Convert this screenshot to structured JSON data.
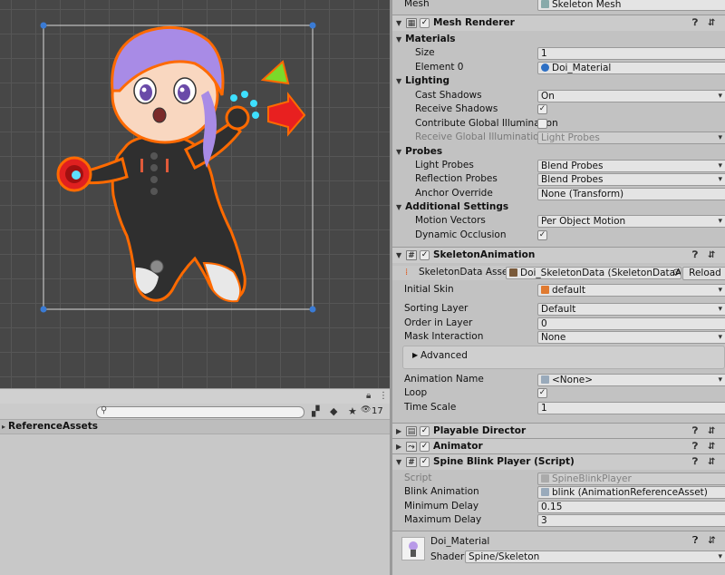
{
  "project": {
    "search_placeholder": "",
    "hidden_count": "17",
    "folder": "ReferenceAssets"
  },
  "inspector": {
    "mesh": {
      "label": "Mesh",
      "value": "Skeleton Mesh"
    },
    "mesh_renderer": {
      "title": "Mesh Renderer",
      "materials": {
        "section": "Materials",
        "size_label": "Size",
        "size": "1",
        "element0_label": "Element 0",
        "element0": "Doi_Material"
      },
      "lighting": {
        "section": "Lighting",
        "cast_shadows_label": "Cast Shadows",
        "cast_shadows": "On",
        "receive_shadows_label": "Receive Shadows",
        "receive_shadows": "✓",
        "contribute_gi_label": "Contribute Global Illumination",
        "contribute_gi": "",
        "receive_gi_label": "Receive Global Illumination",
        "receive_gi": "Light Probes"
      },
      "probes": {
        "section": "Probes",
        "light_probes_label": "Light Probes",
        "light_probes": "Blend Probes",
        "reflection_probes_label": "Reflection Probes",
        "reflection_probes": "Blend Probes",
        "anchor_override_label": "Anchor Override",
        "anchor_override": "None (Transform)"
      },
      "additional": {
        "section": "Additional Settings",
        "motion_vectors_label": "Motion Vectors",
        "motion_vectors": "Per Object Motion",
        "dynamic_occlusion_label": "Dynamic Occlusion",
        "dynamic_occlusion": "✓"
      }
    },
    "skeleton_animation": {
      "title": "SkeletonAnimation",
      "data_asset_label": "SkeletonData Asset",
      "data_asset": "Doi_SkeletonData (SkeletonDataAsset)",
      "reload": "Reload",
      "initial_skin_label": "Initial Skin",
      "initial_skin": "default",
      "sorting_layer_label": "Sorting Layer",
      "sorting_layer": "Default",
      "order_in_layer_label": "Order in Layer",
      "order_in_layer": "0",
      "mask_interaction_label": "Mask Interaction",
      "mask_interaction": "None",
      "advanced": "Advanced",
      "animation_name_label": "Animation Name",
      "animation_name": "<None>",
      "loop_label": "Loop",
      "loop": "✓",
      "time_scale_label": "Time Scale",
      "time_scale": "1"
    },
    "playable_director": {
      "title": "Playable Director"
    },
    "animator": {
      "title": "Animator"
    },
    "blink": {
      "title": "Spine Blink Player (Script)",
      "script_label": "Script",
      "script": "SpineBlinkPlayer",
      "blink_animation_label": "Blink Animation",
      "blink_animation": "blink (AnimationReferenceAsset)",
      "min_delay_label": "Minimum Delay",
      "min_delay": "0.15",
      "max_delay_label": "Maximum Delay",
      "max_delay": "3"
    },
    "material": {
      "name": "Doi_Material",
      "shader_label": "Shader",
      "shader": "Spine/Skeleton"
    }
  },
  "colors": {
    "selection_outline": "#ff6a00",
    "handle": "#3a7bd5",
    "hair": "#a88be6"
  }
}
